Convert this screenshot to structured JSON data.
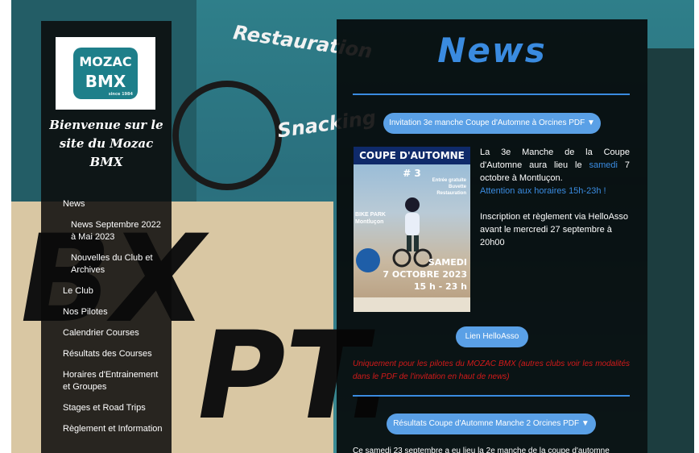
{
  "background": {
    "word_1": "Restauration",
    "word_2": "Snacking",
    "letters_1": "BX",
    "letters_2": "PT."
  },
  "sidebar": {
    "logo_line1": "MOZAC",
    "logo_line2": "BMX",
    "logo_tag": "since 1984",
    "welcome": "Bienvenue sur le site du Mozac BMX",
    "nav": [
      {
        "label": "News",
        "sub": false
      },
      {
        "label": "News Septembre 2022 à Mai 2023",
        "sub": true
      },
      {
        "label": "Nouvelles du Club et Archives",
        "sub": true
      },
      {
        "label": "Le Club",
        "sub": false
      },
      {
        "label": "Nos Pilotes",
        "sub": false
      },
      {
        "label": "Calendrier Courses",
        "sub": false
      },
      {
        "label": "Résultats des Courses",
        "sub": false
      },
      {
        "label": "Horaires d'Entrainement et Groupes",
        "sub": false
      },
      {
        "label": "Stages et Road Trips",
        "sub": false
      },
      {
        "label": "Règlement et Information",
        "sub": false
      }
    ]
  },
  "main": {
    "title": "News",
    "pill_invitation": "Invitation 3e manche Coupe d'Automne à Orcines PDF ▼",
    "poster": {
      "title": "COUPE D'AUTOMNE # 3",
      "meta": "Entrée gratuite\nBuvette\nRestauration",
      "venue": "BIKE PARK\nMontluçon",
      "day": "SAMEDI",
      "date": "7 OCTOBRE 2023",
      "hours": "15 h - 23 h"
    },
    "intro_a": "La 3e Manche de la Coupe d'Automne aura lieu le",
    "intro_highlight": "samedi",
    "intro_b": "7 octobre à Montluçon.",
    "intro_attention": "Attention aux horaires 15h-23h !",
    "intro_c": "Inscription et règlement via HelloAsso avant le mercredi 27 septembre à 20h00",
    "pill_helloasso": "Lien HelloAsso",
    "warning": "Uniquement pour les pilotes du MOZAC BMX (autres clubs voir les modalités dans le PDF de l'invitation en haut de news)",
    "pill_results": "Résultats Coupe d'Automne Manche 2 Orcines PDF ▼",
    "cut_text": "Ce samedi 23 septembre a eu lieu la 2e manche de la coupe d'automne"
  }
}
